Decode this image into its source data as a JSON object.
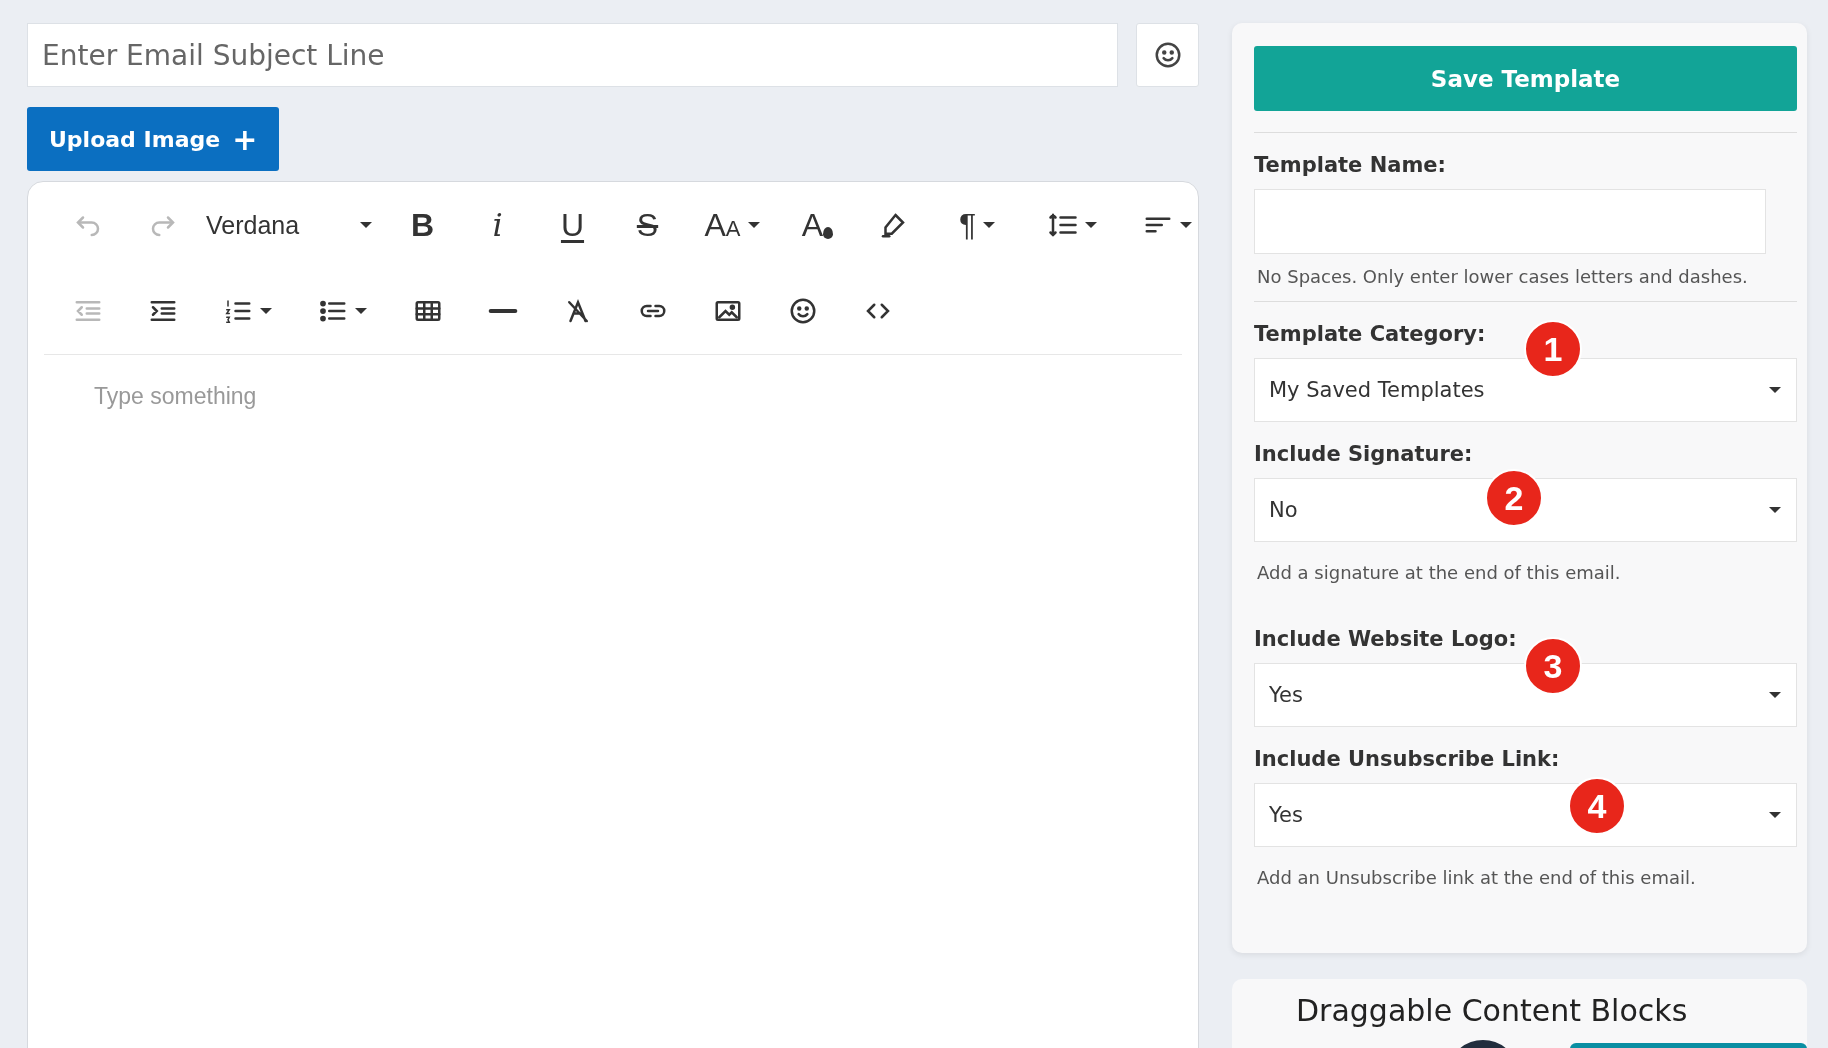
{
  "subject": {
    "placeholder": "Enter Email Subject Line"
  },
  "upload_button": {
    "label": "Upload Image",
    "icon": "+"
  },
  "editor": {
    "font": "Verdana",
    "placeholder": "Type something",
    "toolbar": [
      [
        {
          "kind": "undo",
          "disabled": true,
          "dropdown": false
        },
        {
          "kind": "redo",
          "disabled": true,
          "dropdown": false
        },
        {
          "kind": "font",
          "disabled": false,
          "dropdown": true
        },
        {
          "kind": "bold",
          "glyph": "B",
          "disabled": false,
          "dropdown": false
        },
        {
          "kind": "italic",
          "glyph": "i",
          "disabled": false,
          "dropdown": false
        },
        {
          "kind": "underline",
          "glyph": "U",
          "disabled": false,
          "dropdown": false
        },
        {
          "kind": "strikethrough",
          "glyph": "S",
          "disabled": false,
          "dropdown": false
        },
        {
          "kind": "font-size",
          "glyph": "A",
          "glyph2": "A",
          "disabled": false,
          "dropdown": true
        },
        {
          "kind": "text-color",
          "glyph": "A",
          "disabled": false,
          "dropdown": false
        },
        {
          "kind": "highlight",
          "disabled": false,
          "dropdown": false
        },
        {
          "kind": "paragraph",
          "glyph": "¶",
          "disabled": false,
          "dropdown": true
        },
        {
          "kind": "line-height",
          "disabled": false,
          "dropdown": true
        },
        {
          "kind": "align",
          "disabled": false,
          "dropdown": true
        }
      ],
      [
        {
          "kind": "outdent",
          "disabled": true,
          "dropdown": false
        },
        {
          "kind": "indent",
          "disabled": false,
          "dropdown": false
        },
        {
          "kind": "ordered-list",
          "disabled": false,
          "dropdown": true
        },
        {
          "kind": "bullet-list",
          "disabled": false,
          "dropdown": true
        },
        {
          "kind": "table",
          "disabled": false,
          "dropdown": false
        },
        {
          "kind": "rule",
          "disabled": false,
          "dropdown": false
        },
        {
          "kind": "clear-format",
          "disabled": false,
          "dropdown": false
        },
        {
          "kind": "link",
          "disabled": false,
          "dropdown": false
        },
        {
          "kind": "image",
          "disabled": false,
          "dropdown": false
        },
        {
          "kind": "emoji",
          "disabled": false,
          "dropdown": false
        },
        {
          "kind": "code",
          "disabled": false,
          "dropdown": false
        }
      ]
    ]
  },
  "panel": {
    "save_button": "Save Template",
    "fields": [
      {
        "kind": "input",
        "label": "Template Name:",
        "hint": "No Spaces. Only enter lower cases letters and dashes.",
        "divider": true
      },
      {
        "kind": "select",
        "label": "Template Category:",
        "value": "My Saved Templates"
      },
      {
        "kind": "select",
        "label": "Include Signature:",
        "value": "No",
        "hint": "Add a signature at the end of this email."
      },
      {
        "kind": "select",
        "label": "Include Website Logo:",
        "value": "Yes"
      },
      {
        "kind": "select",
        "label": "Include Unsubscribe Link:",
        "value": "Yes",
        "hint": "Add an Unsubscribe link at the end of this email."
      }
    ]
  },
  "annotations": [
    {
      "label": "1"
    },
    {
      "label": "2"
    },
    {
      "label": "3"
    },
    {
      "label": "4"
    }
  ],
  "blocks_heading": "Draggable Content Blocks"
}
